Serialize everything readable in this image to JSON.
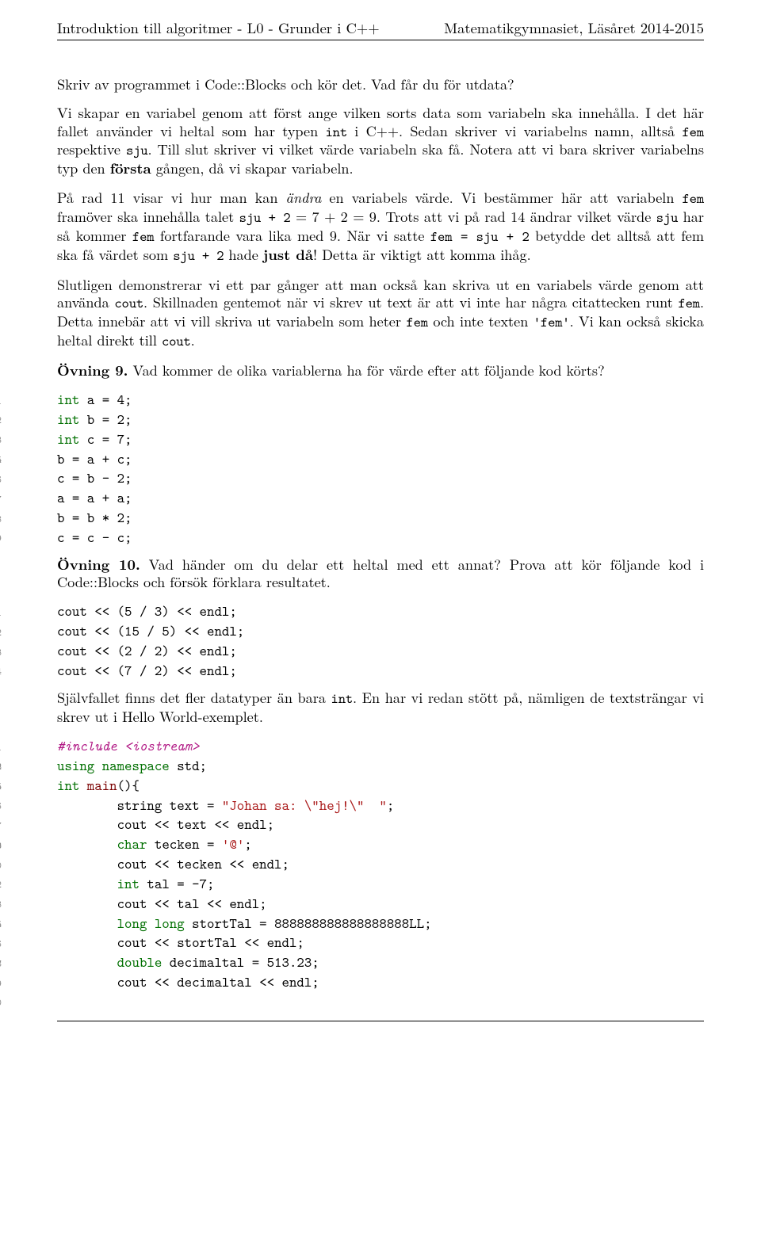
{
  "header": {
    "left": "Introduktion till algoritmer - L0 - Grunder i C++",
    "right": "Matematikgymnasiet, Läsåret 2014-2015"
  },
  "p1": "Skriv av programmet i Code::Blocks och kör det. Vad får du för utdata?",
  "p2a": "Vi skapar en variabel genom att först ange vilken sorts data som variabeln ska innehålla. I det här fallet använder vi heltal som har typen ",
  "p2b": " i C++. Sedan skriver vi variabelns namn, alltså ",
  "p2c": " respektive ",
  "p2d": ". Till slut skriver vi vilket värde variabeln ska få. Notera att vi bara skriver variabelns typ den ",
  "p2e": "första",
  "p2f": " gången, då vi skapar variabeln.",
  "p3a": "På rad 11 visar vi hur man kan ",
  "p3b": "ändra",
  "p3c": " en variabels värde. Vi bestämmer här att variabeln ",
  "p3d": " framöver ska innehålla talet ",
  "p3e": " = 7 + 2 = 9. Trots att vi på rad 14 ändrar vilket värde ",
  "p3f": " har så kommer ",
  "p3g": " fortfarande vara lika med 9. När vi satte ",
  "p3h": " betydde det alltså att fem ska få värdet som ",
  "p3i": " hade ",
  "p3j": "just då",
  "p3k": "! Detta är viktigt att komma ihåg.",
  "p4a": "Slutligen demonstrerar vi ett par gånger att man också kan skriva ut en variabels värde genom att använda ",
  "p4b": ". Skillnaden gentemot när vi skrev ut text är att vi inte har några citattecken runt ",
  "p4c": ". Detta innebär att vi vill skriva ut variabeln som heter ",
  "p4d": " och inte texten ",
  "p4e": ". Vi kan också skicka heltal direkt till ",
  "p4f": ".",
  "ex9label": "Övning 9.",
  "ex9text": " Vad kommer de olika variablerna ha för värde efter att följande kod körts?",
  "code1": {
    "kw_int": "int",
    "a": "a",
    "b": "b",
    "c": "c",
    "l1": "int a = 4;",
    "l2": "int b = 2;",
    "l3": "int c = 7;",
    "l5": "b = a + c;",
    "l6": "c = b - 2;",
    "l7": "a = a + a;",
    "l8": "b = b * 2;",
    "l9": "c = c - c;"
  },
  "ex10label": "Övning 10.",
  "ex10text": " Vad händer om du delar ett heltal med ett annat? Prova att kör följande kod i Code::Blocks och försök förklara resultatet.",
  "code2": {
    "l1": "cout << (5 / 3) << endl;",
    "l2": "cout << (15 / 5) << endl;",
    "l3": "cout << (2 / 2) << endl;",
    "l4": "cout << (7 / 2) << endl;"
  },
  "p5a": "Självfallet finns det fler datatyper än bara ",
  "p5b": ". En har vi redan stött på, nämligen de textsträngar vi skrev ut i Hello World-exemplet.",
  "code3": {
    "include": "#include <iostream>",
    "using_kw": "using namespace",
    "std": " std;",
    "int": "int",
    "main": " main",
    "brace": "(){",
    "l6a": "        string text = ",
    "l6b": "\"Johan sa: \\\"hej!\\\"  \"",
    "l6c": ";",
    "l7": "        cout << text << endl;",
    "l9a": "        ",
    "l9b": "char",
    "l9c": " tecken = ",
    "l9d": "'@'",
    "l9e": ";",
    "l10": "        cout << tecken << endl;",
    "l12a": "        ",
    "l12b": "int",
    "l12c": " tal = -7;",
    "l13": "        cout << tal << endl;",
    "l15a": "        ",
    "l15b": "long long",
    "l15c": " stortTal = 888888888888888888LL;",
    "l16": "        cout << stortTal << endl;",
    "l18a": "        ",
    "l18b": "double",
    "l18c": " decimaltal = 513.23;",
    "l19": "        cout << decimaltal << endl;"
  },
  "tt": {
    "int": "int",
    "fem": "fem",
    "sju": "sju",
    "cout": "cout",
    "sjuplus2": "sju + 2",
    "femeqsjuplus2": "fem = sju + 2",
    "femquote": "'fem'"
  }
}
